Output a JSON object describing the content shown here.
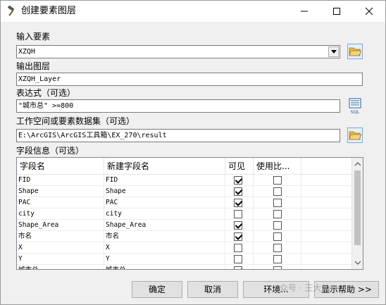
{
  "window": {
    "title": "创建要素图层",
    "icons": [
      "hammer-icon",
      "minimize-icon",
      "maximize-icon",
      "close-icon"
    ]
  },
  "input_features": {
    "label": "输入要素",
    "value": "XZQH"
  },
  "output_layer": {
    "label": "输出图层",
    "value": "XZQH_Layer"
  },
  "expression": {
    "label": "表达式（可选）",
    "value": "\"城市总\" >=800",
    "sql_label": "SQL"
  },
  "workspace": {
    "label": "工作空间或要素数据集（可选）",
    "value": "E:\\ArcGIS\\ArcGIS工具箱\\EX_270\\result"
  },
  "field_info": {
    "label": "字段信息（可选）",
    "headers": [
      "字段名",
      "新建字段名",
      "可见",
      "使用比..."
    ],
    "rows": [
      {
        "name": "FID",
        "new_name": "FID",
        "visible": true,
        "use_ratio": false
      },
      {
        "name": "Shape",
        "new_name": "Shape",
        "visible": true,
        "use_ratio": false
      },
      {
        "name": "PAC",
        "new_name": "PAC",
        "visible": true,
        "use_ratio": false
      },
      {
        "name": "city",
        "new_name": "city",
        "visible": false,
        "use_ratio": false
      },
      {
        "name": "Shape_Area",
        "new_name": "Shape_Area",
        "visible": true,
        "use_ratio": false
      },
      {
        "name": "市名",
        "new_name": "市名",
        "visible": true,
        "use_ratio": false
      },
      {
        "name": "X",
        "new_name": "X",
        "visible": false,
        "use_ratio": false
      },
      {
        "name": "Y",
        "new_name": "Y",
        "visible": false,
        "use_ratio": false
      },
      {
        "name": "城市总",
        "new_name": "城市总",
        "visible": true,
        "use_ratio": false
      }
    ]
  },
  "buttons": {
    "ok": "确定",
    "cancel": "取消",
    "environments": "环境...",
    "show_help": "显示帮助 >>"
  },
  "watermark": "众号 · 王大仙"
}
